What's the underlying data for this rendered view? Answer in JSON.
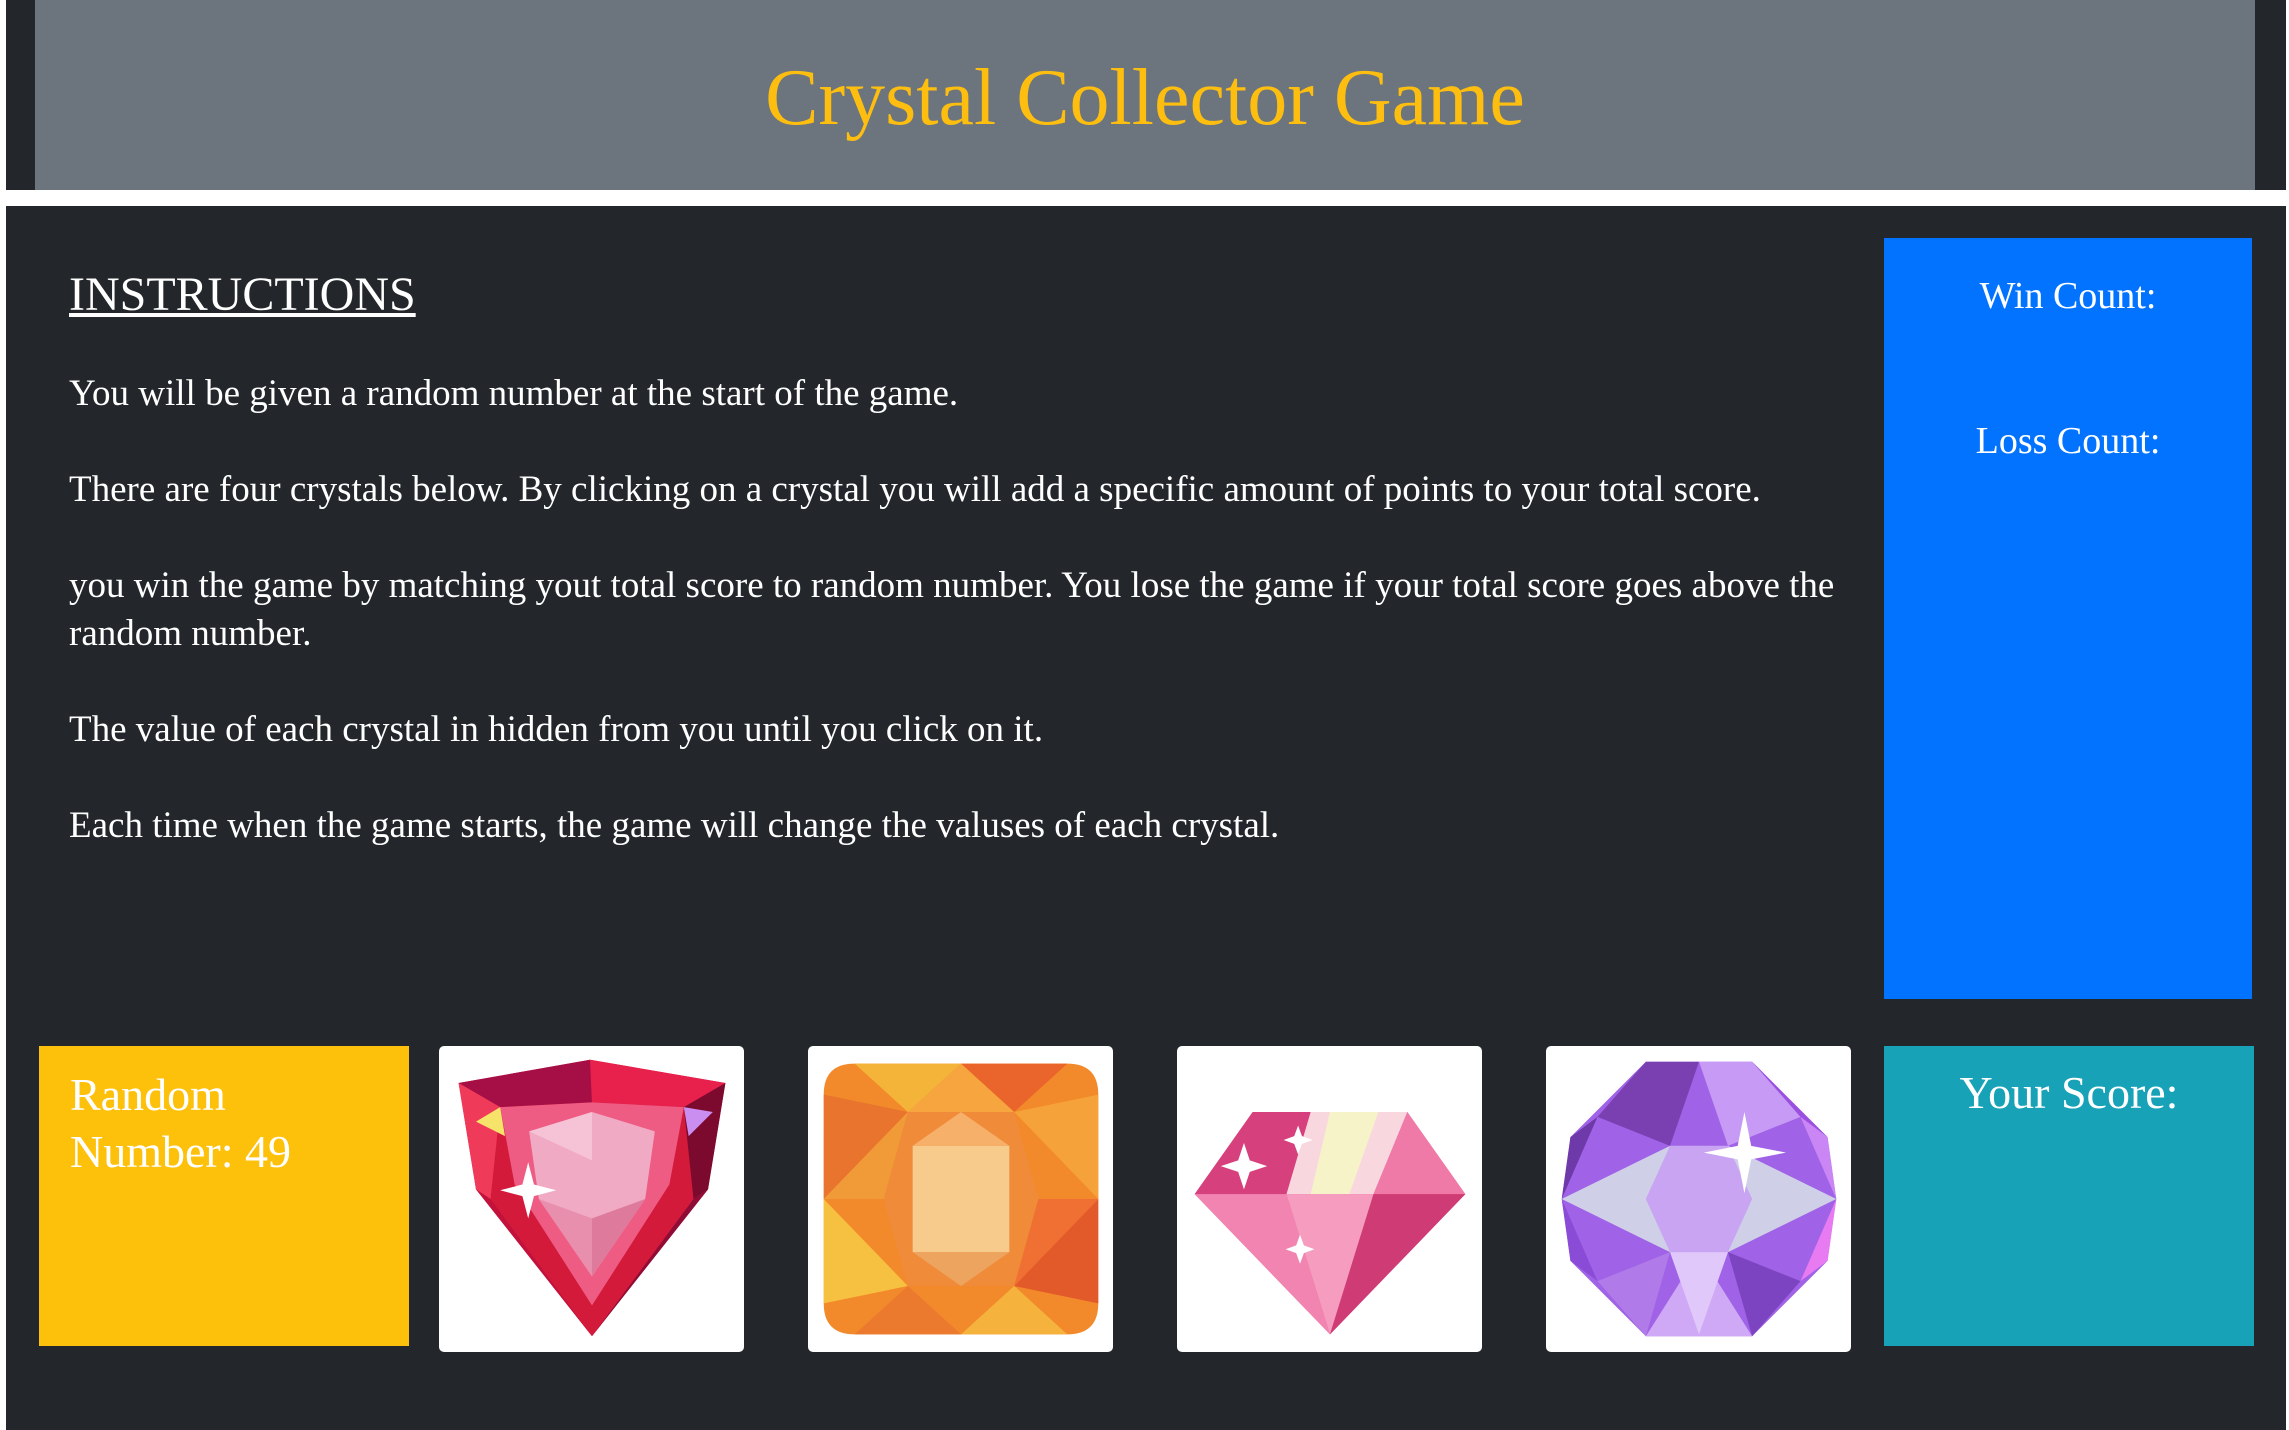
{
  "header": {
    "title": "Crystal Collector Game"
  },
  "instructions": {
    "heading": "INSTRUCTIONS",
    "paragraphs": [
      "You will be given a random number at the start of the game.",
      "There are four crystals below. By clicking on a crystal you will add a specific amount of points to your total score.",
      "you win the game by matching yout total score to random number. You lose the game if your total score goes above the random number.",
      "The value of each crystal in hidden from you until you click on it.",
      "Each time when the game starts, the game will change the valuses of each crystal."
    ]
  },
  "counts": {
    "win_label": "Win Count:",
    "loss_label": "Loss Count:"
  },
  "random": {
    "label": "Random Number: 49"
  },
  "crystals": [
    {
      "icon": "red-trillion-crystal-icon",
      "color": "#e0213f"
    },
    {
      "icon": "orange-cushion-crystal-icon",
      "color": "#f5862b"
    },
    {
      "icon": "pink-diamond-crystal-icon",
      "color": "#f0609c"
    },
    {
      "icon": "purple-octagon-crystal-icon",
      "color": "#a366ea"
    }
  ],
  "score": {
    "label": "Your Score:"
  },
  "colors": {
    "header_bg": "#6c747d",
    "title": "#fdbe10",
    "panel_bg": "#23272b",
    "counts_bg": "#0173ff",
    "random_bg": "#fec10b",
    "score_bg": "#17a2b8"
  }
}
